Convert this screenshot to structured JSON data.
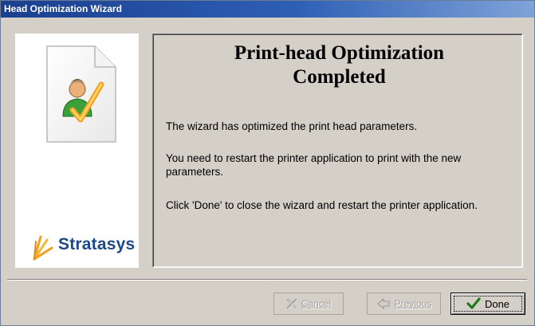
{
  "window": {
    "title": "Head Optimization Wizard"
  },
  "sidebar": {
    "icon": "document-user-check-icon",
    "brand_logo": "stratasys-logo",
    "brand_name": "Stratasys"
  },
  "content": {
    "heading_line1": "Print-head Optimization",
    "heading_line2": "Completed",
    "message1": "The wizard has optimized the print head parameters.",
    "message2": "You need to restart the printer application to print with the new parameters.",
    "message3": "Click 'Done' to close the wizard and restart the printer application."
  },
  "buttons": {
    "cancel": {
      "label": "Cancel",
      "icon": "cancel-x-icon",
      "enabled": false
    },
    "previous": {
      "label": "Previous",
      "icon": "previous-arrow-icon",
      "enabled": false
    },
    "done": {
      "label": "Done",
      "icon": "checkmark-icon",
      "enabled": true
    }
  },
  "colors": {
    "titlebar": "#1a3f8f",
    "dialog_bg": "#d4d0c8",
    "brand_blue": "#1b4a86",
    "check_green": "#1f7a1f"
  }
}
